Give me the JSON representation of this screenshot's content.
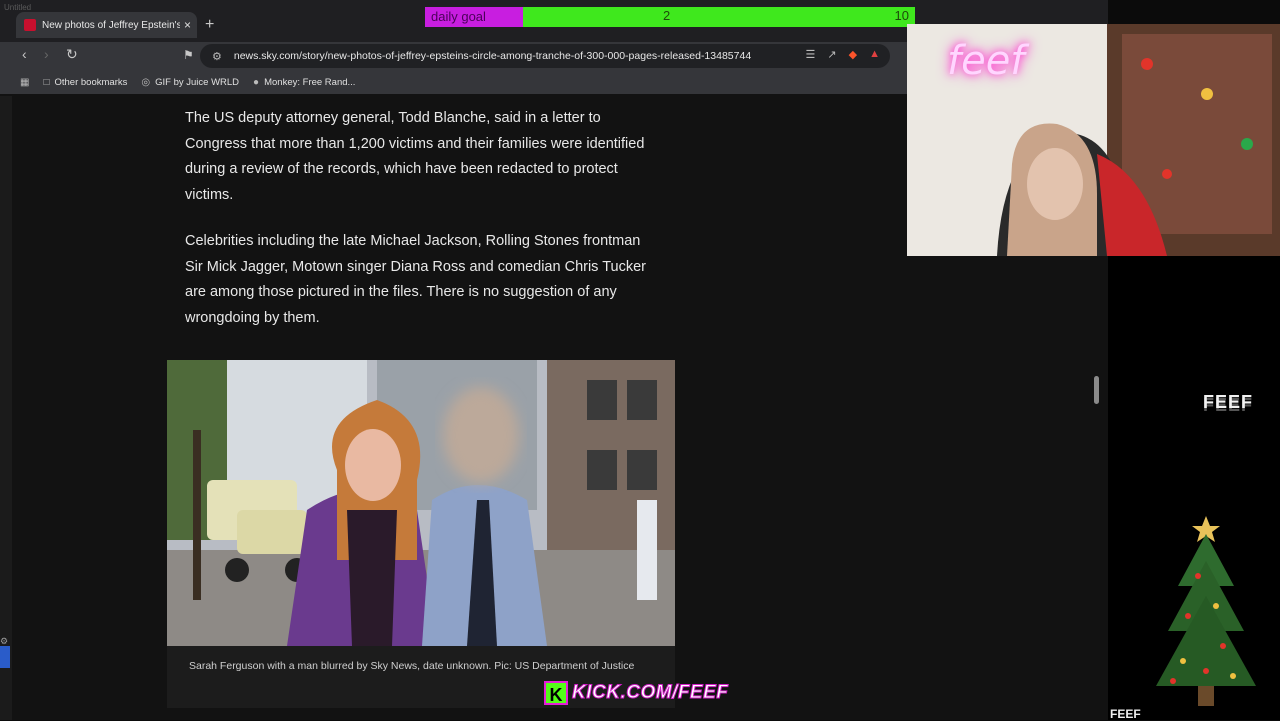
{
  "window": {
    "ghost_title": "Untitled"
  },
  "tab": {
    "title": "New photos of Jeffrey Epstein's c",
    "close": "×"
  },
  "toolbar": {
    "new_tab": "+",
    "url": "news.sky.com/story/new-photos-of-jeffrey-epsteins-circle-among-tranche-of-300-000-pages-released-13485744"
  },
  "bookmarks": [
    {
      "label": "Other bookmarks",
      "icon": "folder-icon"
    },
    {
      "label": "GIF by Juice WRLD",
      "icon": "globe-icon"
    },
    {
      "label": "Monkey: Free Rand...",
      "icon": "monkey-icon"
    }
  ],
  "article": {
    "para1": "The US deputy attorney general, Todd Blanche, said in a letter to Congress that more than 1,200 victims and their families were identified during a review of the records, which have been redacted to protect victims.",
    "para2": "Celebrities including the late Michael Jackson, Rolling Stones frontman Sir Mick Jagger, Motown singer Diana Ross and comedian Chris Tucker are among those pictured in the files. There is no suggestion of any wrongdoing by them.",
    "caption": "Sarah Ferguson with a man blurred by Sky News, date unknown. Pic: US Department of Justice"
  },
  "goal": {
    "label": "daily goal",
    "current": "2",
    "target": "10",
    "progress": 0.2
  },
  "webcam": {
    "neon": "feef"
  },
  "overlay": {
    "logo": "FEEF",
    "bottom_text": "FEEF",
    "kick_k": "K",
    "kick_url": "KICK.COM/FEEF"
  },
  "colors": {
    "accent": "#3fe81d",
    "goal_label": "#c81ee0",
    "kick_green": "#53fc18"
  }
}
